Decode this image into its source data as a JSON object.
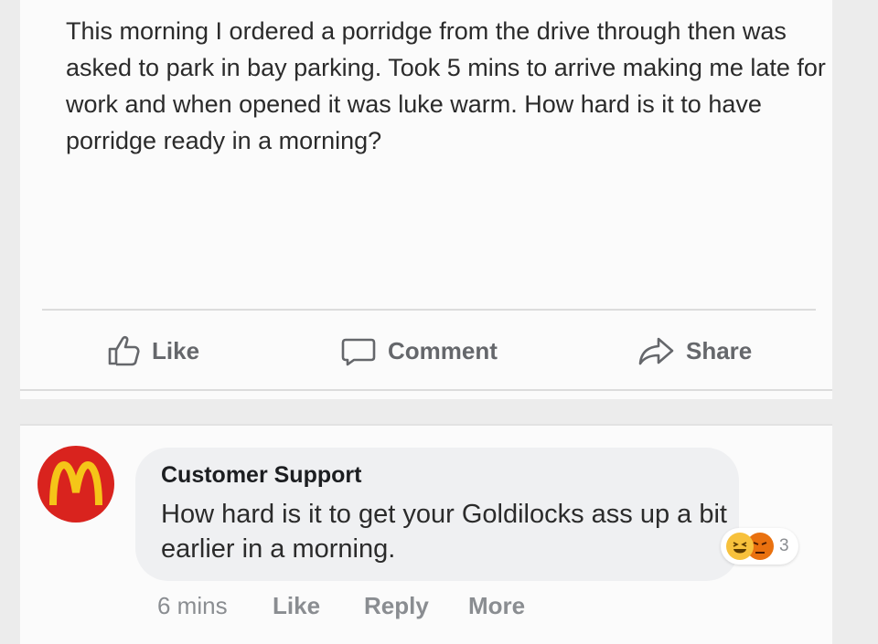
{
  "post": {
    "text": "This morning I ordered a porridge from the drive through then was asked to park in bay parking. Took 5 mins to arrive making me late for work and when opened it was luke warm. How hard is it to have porridge ready in a morning?"
  },
  "actions": {
    "like_label": "Like",
    "comment_label": "Comment",
    "share_label": "Share",
    "icons": [
      "thumbs-up-icon",
      "comment-icon",
      "share-icon"
    ]
  },
  "comment": {
    "author": "Customer Support",
    "text": "How hard is it to get your Goldilocks ass up a bit earlier in a morning.",
    "reactions": {
      "types": [
        "haha",
        "angry"
      ],
      "count": "3"
    },
    "meta": {
      "time": "6 mins",
      "like_label": "Like",
      "reply_label": "Reply",
      "more_label": "More"
    },
    "avatar_color": "#d9231e",
    "logo_color": "#f5c518"
  }
}
